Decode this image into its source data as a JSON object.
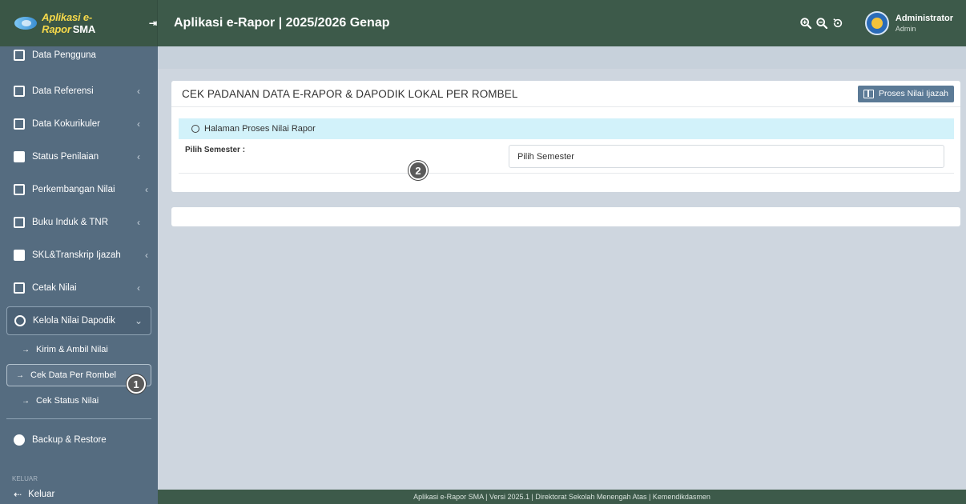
{
  "brand": {
    "name": "Aplikasi e-Rapor",
    "suffix": "SMA"
  },
  "header": {
    "title": "Aplikasi e-Rapor | 2025/2026 Genap"
  },
  "user": {
    "name": "Administrator",
    "role": "Admin"
  },
  "sidebar": {
    "items": [
      {
        "label": "Data Pengguna"
      },
      {
        "label": "Data Referensi"
      },
      {
        "label": "Data Kokurikuler"
      },
      {
        "label": "Status Penilaian"
      },
      {
        "label": "Perkembangan Nilai"
      },
      {
        "label": "Buku Induk & TNR"
      },
      {
        "label": "SKL&Transkrip Ijazah"
      },
      {
        "label": "Cetak Nilai"
      },
      {
        "label": "Kelola Nilai Dapodik"
      }
    ],
    "sub_items": [
      {
        "label": "Kirim & Ambil Nilai"
      },
      {
        "label": "Cek Data Per Rombel"
      },
      {
        "label": "Cek Status Nilai"
      }
    ],
    "backup_label": "Backup & Restore",
    "section_label": "KELUAR",
    "logout_label": "Keluar"
  },
  "main": {
    "card_title": "CEK PADANAN DATA E-RAPOR & DAPODIK LOKAL PER ROMBEL",
    "proses_button": "Proses Nilai Ijazah",
    "info_text": "Halaman Proses Nilai Rapor",
    "semester_label": "Pilih Semester :",
    "semester_value": "Pilih Semester"
  },
  "badges": {
    "one": "1",
    "two": "2"
  },
  "footer": {
    "text": "Aplikasi e-Rapor SMA | Versi 2025.1 | Direktorat Sekolah Menengah Atas | Kemendikdasmen"
  },
  "colors": {
    "header_bg": "#3d5a4a",
    "sidebar_bg": "#556c80",
    "content_bg": "#ced6df",
    "info_bg": "#d2f2fa",
    "button_bg": "#5b7a96"
  }
}
